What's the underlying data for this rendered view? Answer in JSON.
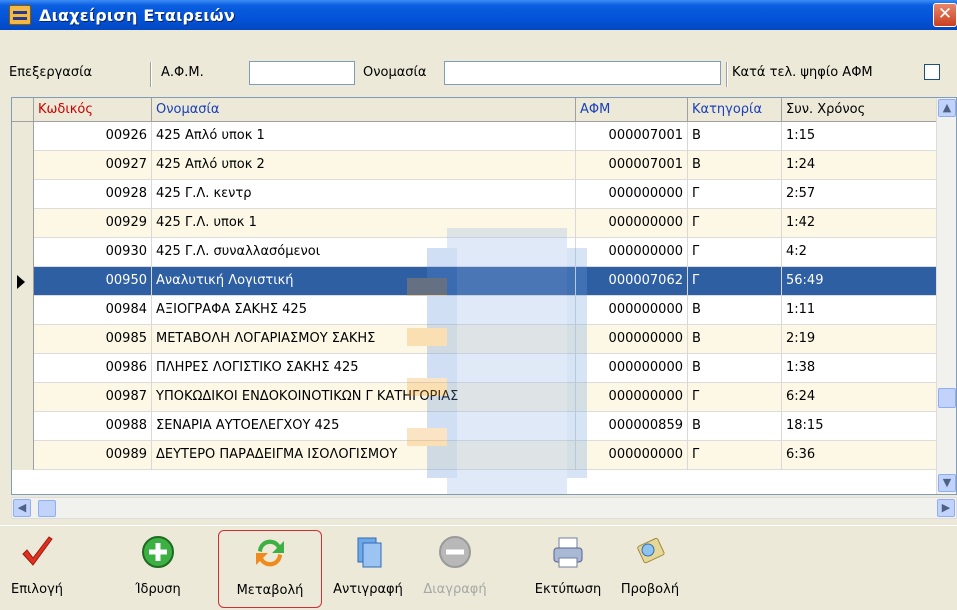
{
  "window": {
    "title": "Διαχείριση Εταιρειών",
    "close_symbol": "✕"
  },
  "filter": {
    "edit_label": "Επεξεργασία",
    "afm_label": "Α.Φ.Μ.",
    "afm_value": "",
    "name_label": "Ονομασία",
    "name_value": "",
    "last_digit_label": "Κατά τελ. ψηφίο ΑΦΜ",
    "last_digit_checked": false
  },
  "grid": {
    "columns": [
      "Κωδικός",
      "Ονομασία",
      "ΑΦΜ",
      "Κατηγορία",
      "Συν. Χρόνος"
    ],
    "header_colors": {
      "code": "#cc0000",
      "name": "#1a3fb8",
      "afm": "#1a3fb8",
      "category": "#1a3fb8",
      "time": "#000000"
    },
    "selected_row": 5,
    "rows": [
      {
        "code": "00926",
        "name": "425 Απλό υποκ 1",
        "afm": "000007001",
        "category": "Β",
        "time": "1:15"
      },
      {
        "code": "00927",
        "name": "425 Απλό υποκ 2",
        "afm": "000007001",
        "category": "Β",
        "time": "1:24"
      },
      {
        "code": "00928",
        "name": "425 Γ.Λ. κεντρ",
        "afm": "000000000",
        "category": "Γ",
        "time": "2:57"
      },
      {
        "code": "00929",
        "name": "425 Γ.Λ. υποκ 1",
        "afm": "000000000",
        "category": "Γ",
        "time": "1:42"
      },
      {
        "code": "00930",
        "name": "425 Γ.Λ. συναλλασόμενοι",
        "afm": "000000000",
        "category": "Γ",
        "time": "4:2"
      },
      {
        "code": "00950",
        "name": "Αναλυτική Λογιστική",
        "afm": "000007062",
        "category": "Γ",
        "time": "56:49"
      },
      {
        "code": "00984",
        "name": "ΑΞΙΟΓΡΑΦΑ ΣΑΚΗΣ 425",
        "afm": "000000000",
        "category": "Β",
        "time": "1:11"
      },
      {
        "code": "00985",
        "name": "ΜΕΤΑΒΟΛΗ ΛΟΓΑΡΙΑΣΜΟΥ ΣΑΚΗΣ",
        "afm": "000000000",
        "category": "Β",
        "time": "2:19"
      },
      {
        "code": "00986",
        "name": "ΠΛΗΡΕΣ ΛΟΓΙΣΤΙΚΟ ΣΑΚΗΣ 425",
        "afm": "000000000",
        "category": "Β",
        "time": "1:38"
      },
      {
        "code": "00987",
        "name": "ΥΠΟΚΩΔΙΚΟΙ ΕΝΔΟΚΟΙΝΟΤΙΚΩΝ Γ ΚΑΤΗΓΟΡΙΑΣ",
        "afm": "000000000",
        "category": "Γ",
        "time": "6:24"
      },
      {
        "code": "00988",
        "name": "ΣΕΝΑΡΙΑ ΑΥΤΟΕΛΕΓΧΟΥ 425",
        "afm": "000000859",
        "category": "Β",
        "time": "18:15"
      },
      {
        "code": "00989",
        "name": "ΔΕΥΤΕΡΟ ΠΑΡΑΔΕΙΓΜΑ ΙΣΟΛΟΓΙΣΜΟΥ",
        "afm": "000000000",
        "category": "Γ",
        "time": "6:36"
      }
    ]
  },
  "toolbar": {
    "select_label": "Επιλογή",
    "create_label": "Ίδρυση",
    "modify_label": "Μεταβολή",
    "copy_label": "Αντιγραφή",
    "delete_label": "Διαγραφή",
    "print_label": "Εκτύπωση",
    "view_label": "Προβολή",
    "icons": [
      "checkmark-icon",
      "plus-circle-icon",
      "refresh-icon",
      "copy-icon",
      "minus-circle-icon",
      "print-icon",
      "view-icon"
    ]
  },
  "colors": {
    "title_bar": "#0453d8",
    "selected_row": "#2f5fa3",
    "alt_row": "#fdf8e6",
    "focus_border": "#d03030"
  }
}
